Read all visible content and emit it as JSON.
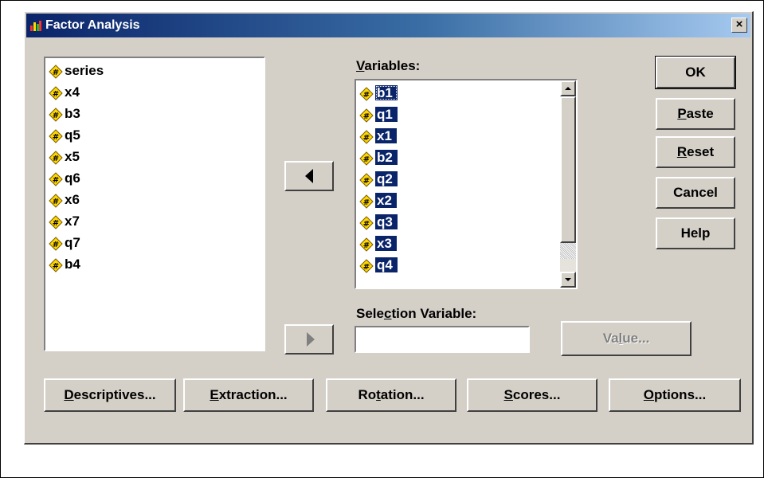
{
  "window": {
    "title": "Factor Analysis",
    "close_glyph": "×"
  },
  "source_list": {
    "items": [
      "series",
      "x4",
      "b3",
      "q5",
      "x5",
      "q6",
      "x6",
      "x7",
      "q7",
      "b4"
    ]
  },
  "variables": {
    "label_accel": "V",
    "label_rest": "ariables:",
    "items": [
      "b1",
      "q1",
      "x1",
      "b2",
      "q2",
      "x2",
      "q3",
      "x3",
      "q4"
    ]
  },
  "selection_variable": {
    "label_pre": "Sele",
    "label_accel": "c",
    "label_post": "tion Variable:",
    "value": ""
  },
  "side_buttons": {
    "ok": "OK",
    "paste_accel": "P",
    "paste_rest": "aste",
    "reset_accel": "R",
    "reset_rest": "eset",
    "cancel": "Cancel",
    "help": "Help"
  },
  "value_button": {
    "pre": "Va",
    "accel": "l",
    "post": "ue..."
  },
  "bottom_buttons": {
    "descriptives_accel": "D",
    "descriptives_rest": "escriptives...",
    "extraction_accel": "E",
    "extraction_rest": "xtraction...",
    "rotation_pre": "Ro",
    "rotation_accel": "t",
    "rotation_post": "ation...",
    "scores_accel": "S",
    "scores_rest": "cores...",
    "options_accel": "O",
    "options_rest": "ptions..."
  },
  "icons": {
    "app": "spss-app-icon",
    "variable": "scale-variable-icon",
    "move_left": "arrow-left-icon",
    "move_right": "arrow-right-icon",
    "scroll_up": "scroll-up-icon",
    "scroll_down": "scroll-down-icon",
    "close": "close-icon"
  },
  "colors": {
    "selection": "#0a246a",
    "title_start": "#0a246a",
    "title_end": "#a6caf0",
    "face": "#d4d0c8"
  }
}
